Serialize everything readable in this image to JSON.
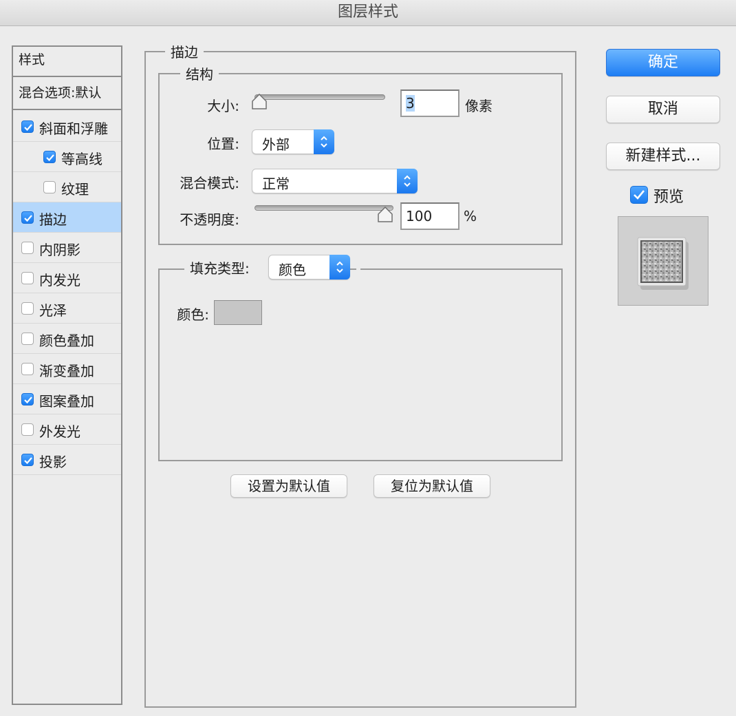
{
  "window": {
    "title": "图层样式"
  },
  "styles_panel": {
    "header": "样式",
    "blend_options": "混合选项:默认",
    "items": [
      {
        "label": "斜面和浮雕",
        "checked": true,
        "indent": false,
        "selected": false
      },
      {
        "label": "等高线",
        "checked": true,
        "indent": true,
        "selected": false
      },
      {
        "label": "纹理",
        "checked": false,
        "indent": true,
        "selected": false
      },
      {
        "label": "描边",
        "checked": true,
        "indent": false,
        "selected": true
      },
      {
        "label": "内阴影",
        "checked": false,
        "indent": false,
        "selected": false
      },
      {
        "label": "内发光",
        "checked": false,
        "indent": false,
        "selected": false
      },
      {
        "label": "光泽",
        "checked": false,
        "indent": false,
        "selected": false
      },
      {
        "label": "颜色叠加",
        "checked": false,
        "indent": false,
        "selected": false
      },
      {
        "label": "渐变叠加",
        "checked": false,
        "indent": false,
        "selected": false
      },
      {
        "label": "图案叠加",
        "checked": true,
        "indent": false,
        "selected": false
      },
      {
        "label": "外发光",
        "checked": false,
        "indent": false,
        "selected": false
      },
      {
        "label": "投影",
        "checked": true,
        "indent": false,
        "selected": false
      }
    ]
  },
  "stroke": {
    "legend": "描边",
    "structure": {
      "legend": "结构",
      "size_label": "大小:",
      "size_value": "3",
      "size_unit": "像素",
      "size_slider_fraction": 0.03,
      "position_label": "位置:",
      "position_value": "外部",
      "blend_mode_label": "混合模式:",
      "blend_mode_value": "正常",
      "opacity_label": "不透明度:",
      "opacity_value": "100",
      "opacity_unit": "%",
      "opacity_slider_fraction": 1.0
    },
    "fill": {
      "type_label": "填充类型:",
      "type_value": "颜色",
      "color_label": "颜色:",
      "color_value": "#c6c6c6"
    },
    "make_default_label": "设置为默认值",
    "reset_default_label": "复位为默认值"
  },
  "actions": {
    "ok_label": "确定",
    "cancel_label": "取消",
    "new_style_label": "新建样式...",
    "preview_label": "预览",
    "preview_checked": true
  },
  "colors": {
    "accent": "#1e7ef4",
    "selection": "#b4d7fb"
  }
}
